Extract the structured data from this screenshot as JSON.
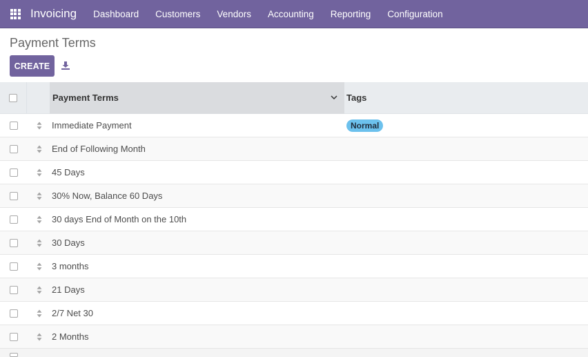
{
  "navbar": {
    "brand": "Invoicing",
    "menu": [
      "Dashboard",
      "Customers",
      "Vendors",
      "Accounting",
      "Reporting",
      "Configuration"
    ]
  },
  "control_panel": {
    "title": "Payment Terms",
    "create_label": "CREATE"
  },
  "table": {
    "columns": [
      "Payment Terms",
      "Tags"
    ],
    "rows": [
      {
        "name": "Immediate Payment",
        "tag": "Normal"
      },
      {
        "name": "End of Following Month",
        "tag": ""
      },
      {
        "name": "45 Days",
        "tag": ""
      },
      {
        "name": "30% Now, Balance 60 Days",
        "tag": ""
      },
      {
        "name": "30 days End of Month on the 10th",
        "tag": ""
      },
      {
        "name": "30 Days",
        "tag": ""
      },
      {
        "name": "3 months",
        "tag": ""
      },
      {
        "name": "21 Days",
        "tag": ""
      },
      {
        "name": "2/7 Net 30",
        "tag": ""
      },
      {
        "name": "2 Months",
        "tag": ""
      }
    ]
  },
  "colors": {
    "brand": "#71639e",
    "tag_normal": "#6cc1ed"
  }
}
